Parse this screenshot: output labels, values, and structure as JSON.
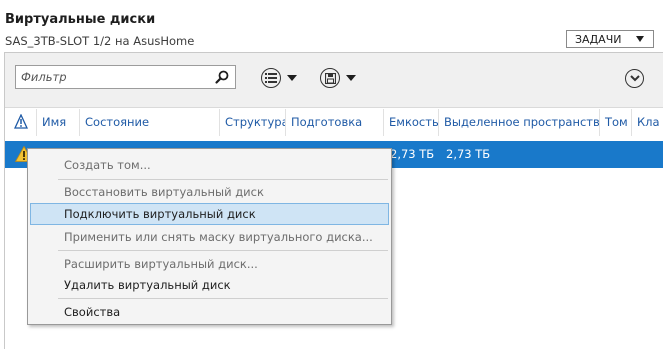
{
  "header": {
    "title": "Виртуальные диски",
    "subtitle": "SAS_3TB-SLOT 1/2 на AsusHome",
    "tasks_label": "ЗАДАЧИ"
  },
  "toolbar": {
    "filter_placeholder": "Фильтр",
    "icons": [
      "search-icon",
      "list-options-icon",
      "save-query-icon",
      "expand-icon"
    ]
  },
  "table": {
    "columns": [
      "Имя",
      "Состояние",
      "Структура",
      "Подготовка",
      "Емкость",
      "Выделенное пространство",
      "Том",
      "Кла"
    ],
    "rows": [
      {
        "status_icon": "warning-icon",
        "capacity": "2,73 ТБ",
        "allocated": "2,73 ТБ"
      }
    ]
  },
  "context_menu": {
    "items": [
      {
        "label": "Создать том...",
        "enabled": false
      },
      {
        "label": "Восстановить виртуальный диск",
        "enabled": false
      },
      {
        "label": "Подключить виртуальный диск",
        "enabled": true,
        "highlighted": true
      },
      {
        "label": "Применить или снять маску виртуального диска...",
        "enabled": false
      },
      {
        "label": "Расширить виртуальный диск...",
        "enabled": false
      },
      {
        "label": "Удалить виртуальный диск",
        "enabled": true
      },
      {
        "label": "Свойства",
        "enabled": true
      }
    ]
  },
  "colors": {
    "selection": "#1979ca",
    "header_link": "#1f5aa6",
    "highlight": "#cfe4f5",
    "warning": "#f2c233"
  }
}
